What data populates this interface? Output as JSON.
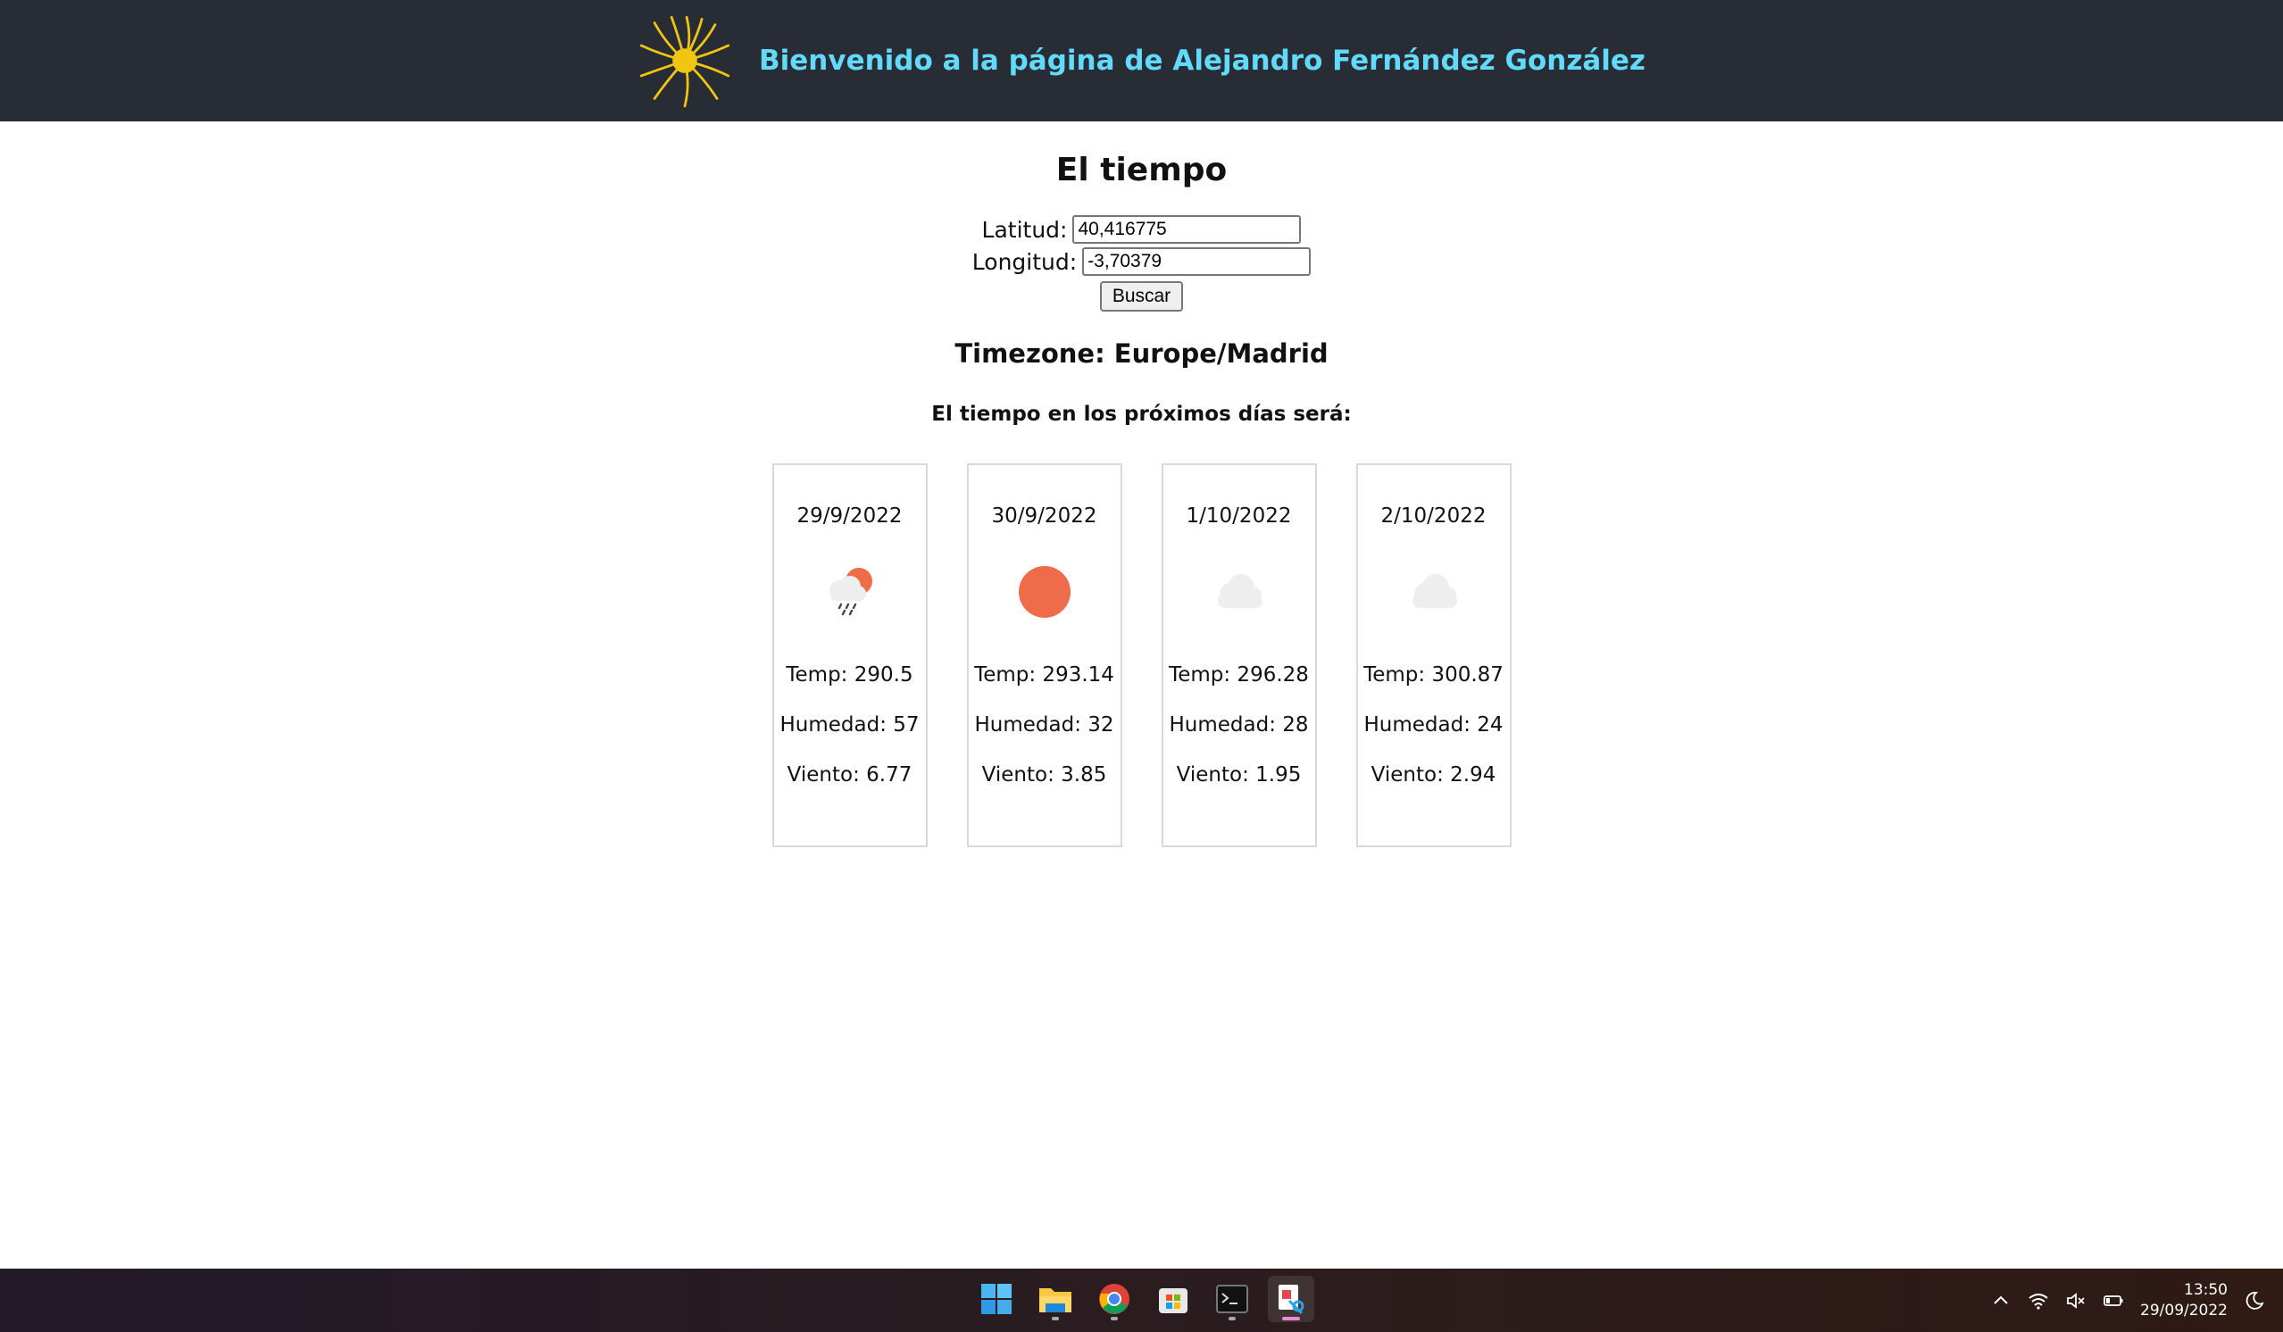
{
  "header": {
    "title": "Bienvenido a la página de Alejandro Fernández González",
    "logo_icon": "sun-logo-icon"
  },
  "main": {
    "title": "El tiempo",
    "latitude_label": "Latitud:",
    "latitude_value": "40,416775",
    "longitude_label": "Longitud:",
    "longitude_value": "-3,70379",
    "search_button": "Buscar",
    "timezone": "Timezone: Europe/Madrid",
    "forecast_heading": "El tiempo en los próximos días será:"
  },
  "forecast": [
    {
      "date": "29/9/2022",
      "icon": "rain-sun-icon",
      "temp": "Temp: 290.5",
      "humidity": "Humedad: 57",
      "wind": "Viento: 6.77"
    },
    {
      "date": "30/9/2022",
      "icon": "sun-icon",
      "temp": "Temp: 293.14",
      "humidity": "Humedad: 32",
      "wind": "Viento: 3.85"
    },
    {
      "date": "1/10/2022",
      "icon": "cloud-icon",
      "temp": "Temp: 296.28",
      "humidity": "Humedad: 28",
      "wind": "Viento: 1.95"
    },
    {
      "date": "2/10/2022",
      "icon": "cloud-icon",
      "temp": "Temp: 300.87",
      "humidity": "Humedad: 24",
      "wind": "Viento: 2.94"
    }
  ],
  "colors": {
    "header_bg": "#282c34",
    "header_text": "#61dafb",
    "sun": "#ef6c4a",
    "cloud": "#eeeeee"
  },
  "taskbar": {
    "apps": [
      "windows-start-icon",
      "file-explorer-icon",
      "chrome-icon",
      "microsoft-store-icon",
      "terminal-icon",
      "snipping-tool-icon"
    ],
    "time": "13:50",
    "date": "29/09/2022"
  }
}
